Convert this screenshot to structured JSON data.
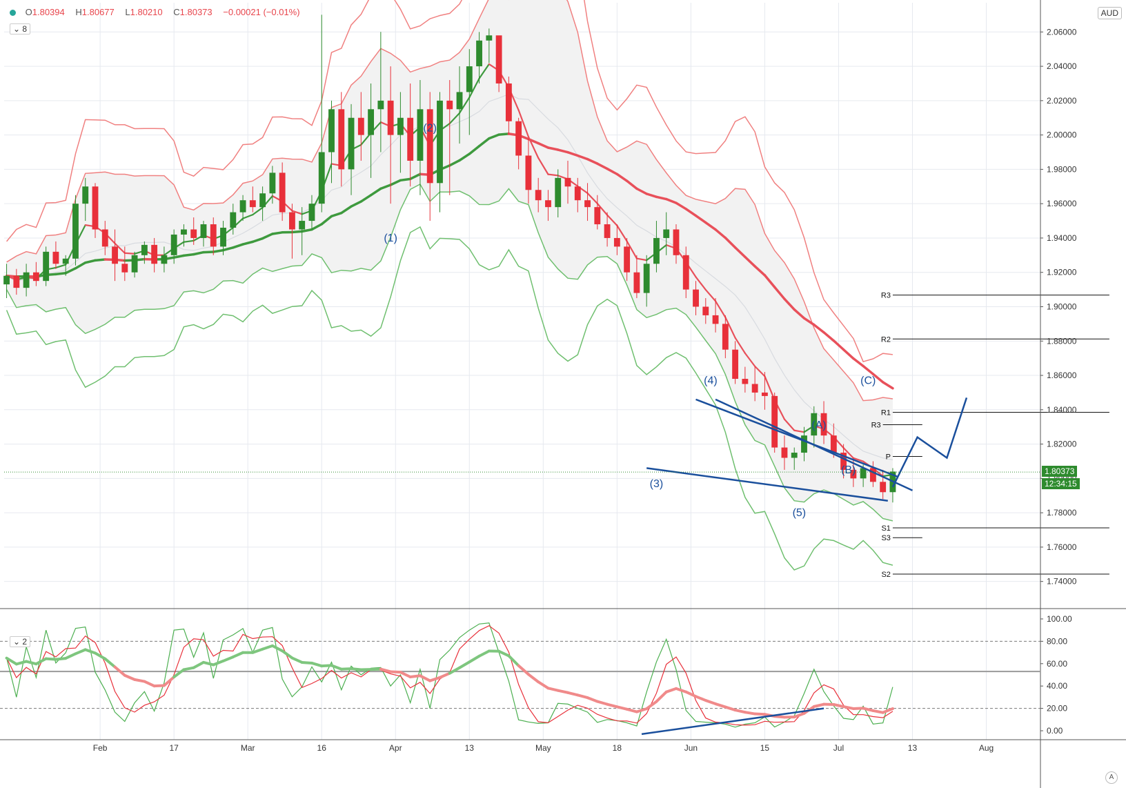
{
  "header": {
    "o_label": "O",
    "o": "1.80394",
    "h_label": "H",
    "h": "1.80677",
    "l_label": "L",
    "l": "1.80210",
    "c_label": "C",
    "c": "1.80373",
    "change": "−0.00021 (−0.01%)",
    "main_pane_toggle": "8",
    "osc_pane_toggle": "2",
    "currency": "AUD",
    "corner_button": "A"
  },
  "colors": {
    "up": "#2e8b2e",
    "down": "#e8303a",
    "elliott": "#1a4f9c",
    "band_fill": "#f2f2f2",
    "green_band": "#6fbf6f",
    "red_band": "#f08080"
  },
  "chart_data": [
    {
      "type": "candlestick",
      "pair": "AUD",
      "y_ticks": [
        1.74,
        1.76,
        1.78,
        1.8,
        1.82,
        1.84,
        1.86,
        1.88,
        1.9,
        1.92,
        1.94,
        1.96,
        1.98,
        2.0,
        2.02,
        2.04,
        2.06
      ],
      "y_tick_labels": [
        "1.74000",
        "1.76000",
        "1.78000",
        "1.80000",
        "1.82000",
        "1.84000",
        "1.86000",
        "1.88000",
        "1.90000",
        "1.92000",
        "1.94000",
        "1.96000",
        "1.98000",
        "2.00000",
        "2.02000",
        "2.04000",
        "2.06000"
      ],
      "ylim": [
        1.725,
        2.077
      ],
      "x_labels": [
        "Feb",
        "17",
        "Mar",
        "16",
        "Apr",
        "13",
        "May",
        "18",
        "Jun",
        "15",
        "Jul",
        "13",
        "Aug"
      ],
      "x_label_pos": [
        19,
        34,
        49,
        64,
        79,
        94,
        109,
        124,
        139,
        154,
        169,
        184,
        199
      ],
      "xlim": [
        -0.5,
        210
      ],
      "last_price": "1.80373",
      "last_price_value": 1.80373,
      "countdown": "12:34:15",
      "candles_ohlc": [
        [
          1.913,
          1.925,
          1.905,
          1.918
        ],
        [
          1.918,
          1.922,
          1.907,
          1.911
        ],
        [
          1.911,
          1.925,
          1.906,
          1.92
        ],
        [
          1.92,
          1.926,
          1.912,
          1.915
        ],
        [
          1.915,
          1.935,
          1.912,
          1.932
        ],
        [
          1.932,
          1.938,
          1.922,
          1.925
        ],
        [
          1.925,
          1.93,
          1.918,
          1.928
        ],
        [
          1.928,
          1.965,
          1.924,
          1.96
        ],
        [
          1.96,
          1.975,
          1.95,
          1.97
        ],
        [
          1.97,
          1.972,
          1.94,
          1.945
        ],
        [
          1.945,
          1.95,
          1.93,
          1.935
        ],
        [
          1.935,
          1.945,
          1.915,
          1.925
        ],
        [
          1.925,
          1.935,
          1.915,
          1.92
        ],
        [
          1.92,
          1.932,
          1.917,
          1.93
        ],
        [
          1.93,
          1.938,
          1.925,
          1.936
        ],
        [
          1.936,
          1.94,
          1.92,
          1.925
        ],
        [
          1.925,
          1.935,
          1.92,
          1.93
        ],
        [
          1.93,
          1.945,
          1.925,
          1.942
        ],
        [
          1.942,
          1.948,
          1.935,
          1.945
        ],
        [
          1.945,
          1.952,
          1.936,
          1.94
        ],
        [
          1.94,
          1.95,
          1.935,
          1.948
        ],
        [
          1.948,
          1.952,
          1.93,
          1.935
        ],
        [
          1.935,
          1.95,
          1.93,
          1.946
        ],
        [
          1.946,
          1.96,
          1.942,
          1.955
        ],
        [
          1.955,
          1.965,
          1.95,
          1.962
        ],
        [
          1.962,
          1.97,
          1.955,
          1.958
        ],
        [
          1.958,
          1.97,
          1.95,
          1.966
        ],
        [
          1.966,
          1.982,
          1.96,
          1.978
        ],
        [
          1.978,
          1.984,
          1.95,
          1.955
        ],
        [
          1.955,
          1.96,
          1.928,
          1.945
        ],
        [
          1.945,
          1.958,
          1.93,
          1.95
        ],
        [
          1.95,
          1.965,
          1.945,
          1.96
        ],
        [
          1.96,
          2.07,
          1.955,
          1.99
        ],
        [
          1.99,
          2.02,
          1.972,
          2.015
        ],
        [
          2.015,
          2.025,
          1.97,
          1.98
        ],
        [
          1.98,
          2.018,
          1.965,
          2.01
        ],
        [
          2.01,
          2.025,
          1.985,
          2.0
        ],
        [
          2.0,
          2.03,
          1.975,
          2.015
        ],
        [
          2.015,
          2.06,
          1.99,
          2.02
        ],
        [
          2.02,
          2.04,
          1.96,
          2.0
        ],
        [
          2.0,
          2.025,
          1.978,
          2.01
        ],
        [
          2.01,
          2.03,
          1.97,
          1.985
        ],
        [
          1.985,
          2.032,
          1.965,
          2.015
        ],
        [
          2.015,
          2.025,
          1.95,
          1.972
        ],
        [
          1.972,
          2.025,
          1.955,
          2.02
        ],
        [
          2.02,
          2.032,
          1.965,
          2.015
        ],
        [
          2.015,
          2.04,
          1.995,
          2.025
        ],
        [
          2.025,
          2.05,
          2.0,
          2.04
        ],
        [
          2.04,
          2.06,
          2.03,
          2.055
        ],
        [
          2.055,
          2.062,
          2.042,
          2.058
        ],
        [
          2.058,
          2.052,
          2.025,
          2.03
        ],
        [
          2.03,
          2.034,
          2.0,
          2.008
        ],
        [
          2.008,
          2.01,
          1.98,
          1.988
        ],
        [
          1.988,
          1.998,
          1.96,
          1.968
        ],
        [
          1.968,
          1.975,
          1.955,
          1.962
        ],
        [
          1.962,
          1.968,
          1.95,
          1.958
        ],
        [
          1.958,
          1.98,
          1.952,
          1.975
        ],
        [
          1.975,
          1.985,
          1.96,
          1.97
        ],
        [
          1.97,
          1.975,
          1.955,
          1.962
        ],
        [
          1.962,
          1.972,
          1.95,
          1.958
        ],
        [
          1.958,
          1.965,
          1.945,
          1.948
        ],
        [
          1.948,
          1.955,
          1.935,
          1.94
        ],
        [
          1.94,
          1.948,
          1.93,
          1.935
        ],
        [
          1.935,
          1.94,
          1.915,
          1.92
        ],
        [
          1.92,
          1.93,
          1.905,
          1.908
        ],
        [
          1.908,
          1.93,
          1.9,
          1.925
        ],
        [
          1.925,
          1.95,
          1.92,
          1.94
        ],
        [
          1.94,
          1.955,
          1.93,
          1.945
        ],
        [
          1.945,
          1.948,
          1.925,
          1.93
        ],
        [
          1.93,
          1.935,
          1.905,
          1.91
        ],
        [
          1.91,
          1.915,
          1.895,
          1.9
        ],
        [
          1.9,
          1.905,
          1.89,
          1.895
        ],
        [
          1.895,
          1.905,
          1.885,
          1.89
        ],
        [
          1.89,
          1.895,
          1.87,
          1.875
        ],
        [
          1.875,
          1.88,
          1.855,
          1.858
        ],
        [
          1.858,
          1.865,
          1.85,
          1.855
        ],
        [
          1.855,
          1.865,
          1.845,
          1.85
        ],
        [
          1.85,
          1.862,
          1.84,
          1.848
        ],
        [
          1.848,
          1.85,
          1.815,
          1.818
        ],
        [
          1.818,
          1.825,
          1.805,
          1.812
        ],
        [
          1.812,
          1.818,
          1.805,
          1.815
        ],
        [
          1.815,
          1.83,
          1.81,
          1.825
        ],
        [
          1.825,
          1.842,
          1.818,
          1.838
        ],
        [
          1.838,
          1.845,
          1.82,
          1.825
        ],
        [
          1.825,
          1.832,
          1.812,
          1.815
        ],
        [
          1.815,
          1.82,
          1.8,
          1.805
        ],
        [
          1.805,
          1.812,
          1.795,
          1.8
        ],
        [
          1.8,
          1.808,
          1.795,
          1.806
        ],
        [
          1.806,
          1.81,
          1.795,
          1.798
        ],
        [
          1.798,
          1.805,
          1.788,
          1.792
        ],
        [
          1.792,
          1.806,
          1.786,
          1.804
        ]
      ],
      "candle_x": [
        0,
        2,
        4,
        6,
        8,
        10,
        12,
        14,
        16,
        18,
        20,
        22,
        24,
        26,
        28,
        30,
        32,
        34,
        36,
        38,
        40,
        42,
        44,
        46,
        48,
        50,
        52,
        54,
        56,
        58,
        60,
        62,
        64,
        66,
        68,
        70,
        72,
        74,
        76,
        78,
        80,
        82,
        84,
        86,
        88,
        90,
        92,
        94,
        96,
        98,
        100,
        102,
        104,
        106,
        108,
        110,
        112,
        114,
        116,
        118,
        120,
        122,
        124,
        126,
        128,
        130,
        132,
        134,
        136,
        138,
        140,
        142,
        144,
        146,
        148,
        150,
        152,
        154,
        156,
        158,
        160,
        162,
        164,
        166,
        168,
        170,
        172,
        174,
        176,
        178,
        180
      ],
      "elliott_labels": [
        {
          "text": "(1)",
          "x": 78,
          "y": 1.938
        },
        {
          "text": "(2)",
          "x": 86,
          "y": 2.002
        },
        {
          "text": "(3)",
          "x": 132,
          "y": 1.795
        },
        {
          "text": "(4)",
          "x": 143,
          "y": 1.855
        },
        {
          "text": "(5)",
          "x": 161,
          "y": 1.778
        },
        {
          "text": "(A)",
          "x": 165,
          "y": 1.829
        },
        {
          "text": "(B)",
          "x": 171,
          "y": 1.803
        },
        {
          "text": "(C)",
          "x": 175,
          "y": 1.855
        }
      ],
      "pivot_levels": [
        {
          "name": "R3",
          "value": 1.9068
        },
        {
          "name": "R2",
          "value": 1.8812
        },
        {
          "name": "R1",
          "value": 1.8385
        },
        {
          "name": "R3",
          "value": 1.8313
        },
        {
          "name": "P",
          "value": 1.8128
        },
        {
          "name": "S1",
          "value": 1.7712
        },
        {
          "name": "S3",
          "value": 1.7655
        },
        {
          "name": "S2",
          "value": 1.7443
        }
      ]
    },
    {
      "type": "line",
      "name": "oscillator",
      "y_ticks": [
        0,
        20,
        40,
        60,
        80,
        100
      ],
      "y_tick_labels": [
        "0.00",
        "20.00",
        "40.00",
        "60.00",
        "80.00",
        "100.00"
      ],
      "ylim": [
        -8,
        108
      ],
      "levels": [
        80,
        53,
        20
      ]
    }
  ]
}
